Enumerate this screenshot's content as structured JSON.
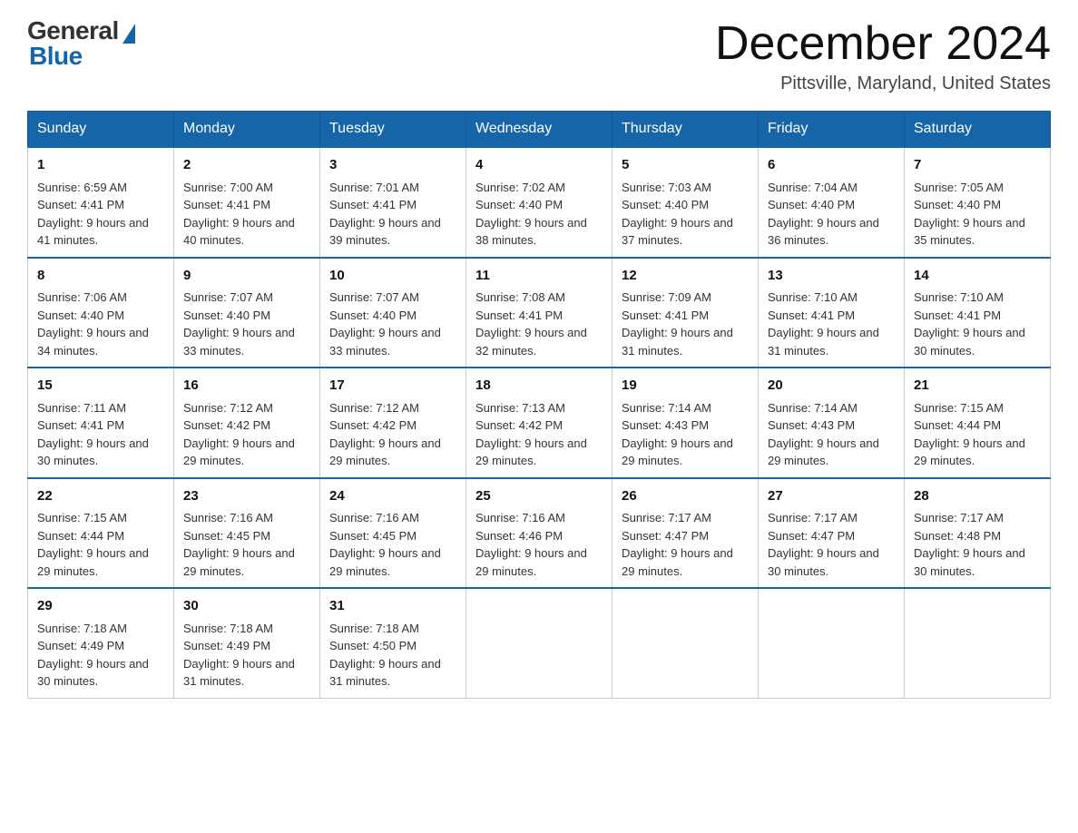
{
  "header": {
    "logo_general": "General",
    "logo_blue": "Blue",
    "title": "December 2024",
    "subtitle": "Pittsville, Maryland, United States"
  },
  "days_of_week": [
    "Sunday",
    "Monday",
    "Tuesday",
    "Wednesday",
    "Thursday",
    "Friday",
    "Saturday"
  ],
  "weeks": [
    [
      {
        "day": "1",
        "sunrise": "6:59 AM",
        "sunset": "4:41 PM",
        "daylight": "9 hours and 41 minutes."
      },
      {
        "day": "2",
        "sunrise": "7:00 AM",
        "sunset": "4:41 PM",
        "daylight": "9 hours and 40 minutes."
      },
      {
        "day": "3",
        "sunrise": "7:01 AM",
        "sunset": "4:41 PM",
        "daylight": "9 hours and 39 minutes."
      },
      {
        "day": "4",
        "sunrise": "7:02 AM",
        "sunset": "4:40 PM",
        "daylight": "9 hours and 38 minutes."
      },
      {
        "day": "5",
        "sunrise": "7:03 AM",
        "sunset": "4:40 PM",
        "daylight": "9 hours and 37 minutes."
      },
      {
        "day": "6",
        "sunrise": "7:04 AM",
        "sunset": "4:40 PM",
        "daylight": "9 hours and 36 minutes."
      },
      {
        "day": "7",
        "sunrise": "7:05 AM",
        "sunset": "4:40 PM",
        "daylight": "9 hours and 35 minutes."
      }
    ],
    [
      {
        "day": "8",
        "sunrise": "7:06 AM",
        "sunset": "4:40 PM",
        "daylight": "9 hours and 34 minutes."
      },
      {
        "day": "9",
        "sunrise": "7:07 AM",
        "sunset": "4:40 PM",
        "daylight": "9 hours and 33 minutes."
      },
      {
        "day": "10",
        "sunrise": "7:07 AM",
        "sunset": "4:40 PM",
        "daylight": "9 hours and 33 minutes."
      },
      {
        "day": "11",
        "sunrise": "7:08 AM",
        "sunset": "4:41 PM",
        "daylight": "9 hours and 32 minutes."
      },
      {
        "day": "12",
        "sunrise": "7:09 AM",
        "sunset": "4:41 PM",
        "daylight": "9 hours and 31 minutes."
      },
      {
        "day": "13",
        "sunrise": "7:10 AM",
        "sunset": "4:41 PM",
        "daylight": "9 hours and 31 minutes."
      },
      {
        "day": "14",
        "sunrise": "7:10 AM",
        "sunset": "4:41 PM",
        "daylight": "9 hours and 30 minutes."
      }
    ],
    [
      {
        "day": "15",
        "sunrise": "7:11 AM",
        "sunset": "4:41 PM",
        "daylight": "9 hours and 30 minutes."
      },
      {
        "day": "16",
        "sunrise": "7:12 AM",
        "sunset": "4:42 PM",
        "daylight": "9 hours and 29 minutes."
      },
      {
        "day": "17",
        "sunrise": "7:12 AM",
        "sunset": "4:42 PM",
        "daylight": "9 hours and 29 minutes."
      },
      {
        "day": "18",
        "sunrise": "7:13 AM",
        "sunset": "4:42 PM",
        "daylight": "9 hours and 29 minutes."
      },
      {
        "day": "19",
        "sunrise": "7:14 AM",
        "sunset": "4:43 PM",
        "daylight": "9 hours and 29 minutes."
      },
      {
        "day": "20",
        "sunrise": "7:14 AM",
        "sunset": "4:43 PM",
        "daylight": "9 hours and 29 minutes."
      },
      {
        "day": "21",
        "sunrise": "7:15 AM",
        "sunset": "4:44 PM",
        "daylight": "9 hours and 29 minutes."
      }
    ],
    [
      {
        "day": "22",
        "sunrise": "7:15 AM",
        "sunset": "4:44 PM",
        "daylight": "9 hours and 29 minutes."
      },
      {
        "day": "23",
        "sunrise": "7:16 AM",
        "sunset": "4:45 PM",
        "daylight": "9 hours and 29 minutes."
      },
      {
        "day": "24",
        "sunrise": "7:16 AM",
        "sunset": "4:45 PM",
        "daylight": "9 hours and 29 minutes."
      },
      {
        "day": "25",
        "sunrise": "7:16 AM",
        "sunset": "4:46 PM",
        "daylight": "9 hours and 29 minutes."
      },
      {
        "day": "26",
        "sunrise": "7:17 AM",
        "sunset": "4:47 PM",
        "daylight": "9 hours and 29 minutes."
      },
      {
        "day": "27",
        "sunrise": "7:17 AM",
        "sunset": "4:47 PM",
        "daylight": "9 hours and 30 minutes."
      },
      {
        "day": "28",
        "sunrise": "7:17 AM",
        "sunset": "4:48 PM",
        "daylight": "9 hours and 30 minutes."
      }
    ],
    [
      {
        "day": "29",
        "sunrise": "7:18 AM",
        "sunset": "4:49 PM",
        "daylight": "9 hours and 30 minutes."
      },
      {
        "day": "30",
        "sunrise": "7:18 AM",
        "sunset": "4:49 PM",
        "daylight": "9 hours and 31 minutes."
      },
      {
        "day": "31",
        "sunrise": "7:18 AM",
        "sunset": "4:50 PM",
        "daylight": "9 hours and 31 minutes."
      },
      null,
      null,
      null,
      null
    ]
  ],
  "labels": {
    "sunrise_prefix": "Sunrise: ",
    "sunset_prefix": "Sunset: ",
    "daylight_prefix": "Daylight: "
  }
}
